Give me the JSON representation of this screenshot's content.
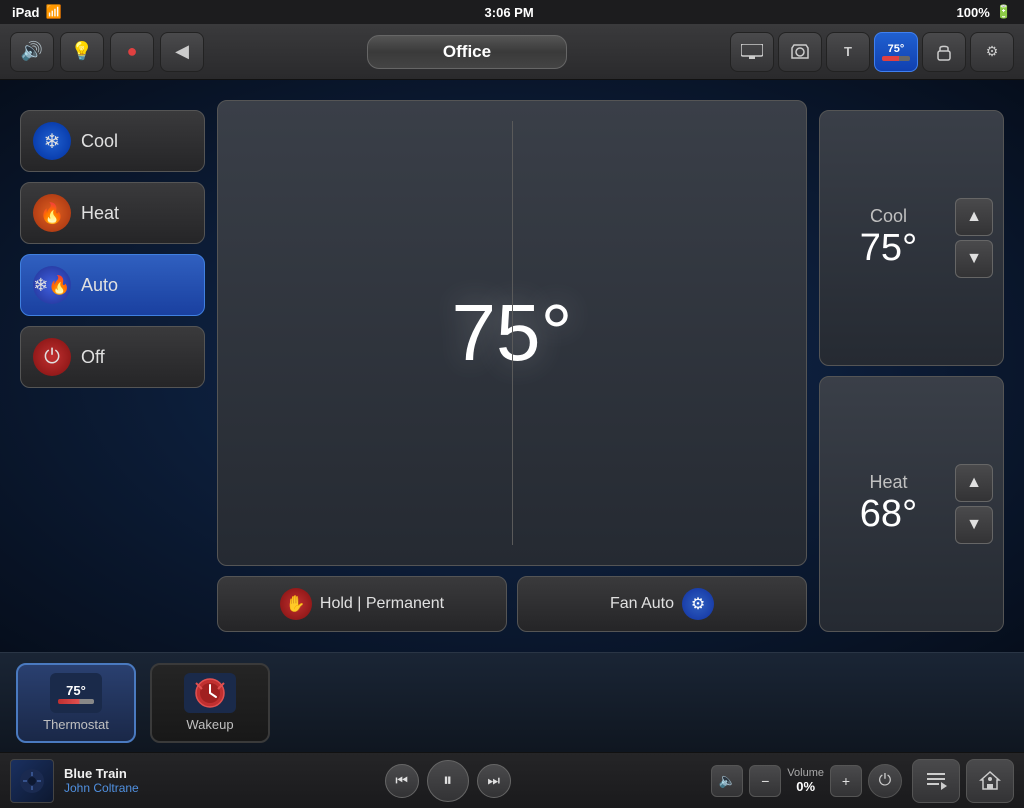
{
  "statusBar": {
    "device": "iPad",
    "wifi": "wifi",
    "time": "3:06 PM",
    "battery": "100%"
  },
  "topNav": {
    "title": "Office",
    "icons": [
      {
        "name": "speaker-icon",
        "symbol": "🔊"
      },
      {
        "name": "light-icon",
        "symbol": "💡"
      },
      {
        "name": "media-icon",
        "symbol": "🔴"
      },
      {
        "name": "back-icon",
        "symbol": "◀"
      }
    ],
    "rightIcons": [
      {
        "name": "display-icon",
        "symbol": "🖥"
      },
      {
        "name": "camera-icon",
        "symbol": "📷"
      },
      {
        "name": "light2-icon",
        "symbol": "T"
      },
      {
        "name": "thermostat-icon",
        "symbol": "🌡",
        "active": true
      },
      {
        "name": "lock-icon",
        "symbol": "🔒"
      },
      {
        "name": "settings-icon",
        "symbol": "⚙"
      }
    ]
  },
  "thermostat": {
    "currentTemp": "75°",
    "modes": [
      {
        "id": "cool",
        "label": "Cool",
        "active": false
      },
      {
        "id": "heat",
        "label": "Heat",
        "active": false
      },
      {
        "id": "auto",
        "label": "Auto",
        "active": true
      },
      {
        "id": "off",
        "label": "Off",
        "active": false
      }
    ],
    "holdButton": "Hold | Permanent",
    "fanButton": "Fan Auto",
    "coolSetpoint": {
      "label": "Cool",
      "value": "75°"
    },
    "heatSetpoint": {
      "label": "Heat",
      "value": "68°"
    }
  },
  "deviceTray": {
    "devices": [
      {
        "id": "thermostat",
        "label": "Thermostat",
        "active": true,
        "tempValue": "75°"
      },
      {
        "id": "wakeup",
        "label": "Wakeup",
        "active": false
      }
    ]
  },
  "musicBar": {
    "trackTitle": "Blue Train",
    "trackArtist": "John Coltrane",
    "volume": {
      "label": "Volume",
      "value": "0%"
    }
  }
}
